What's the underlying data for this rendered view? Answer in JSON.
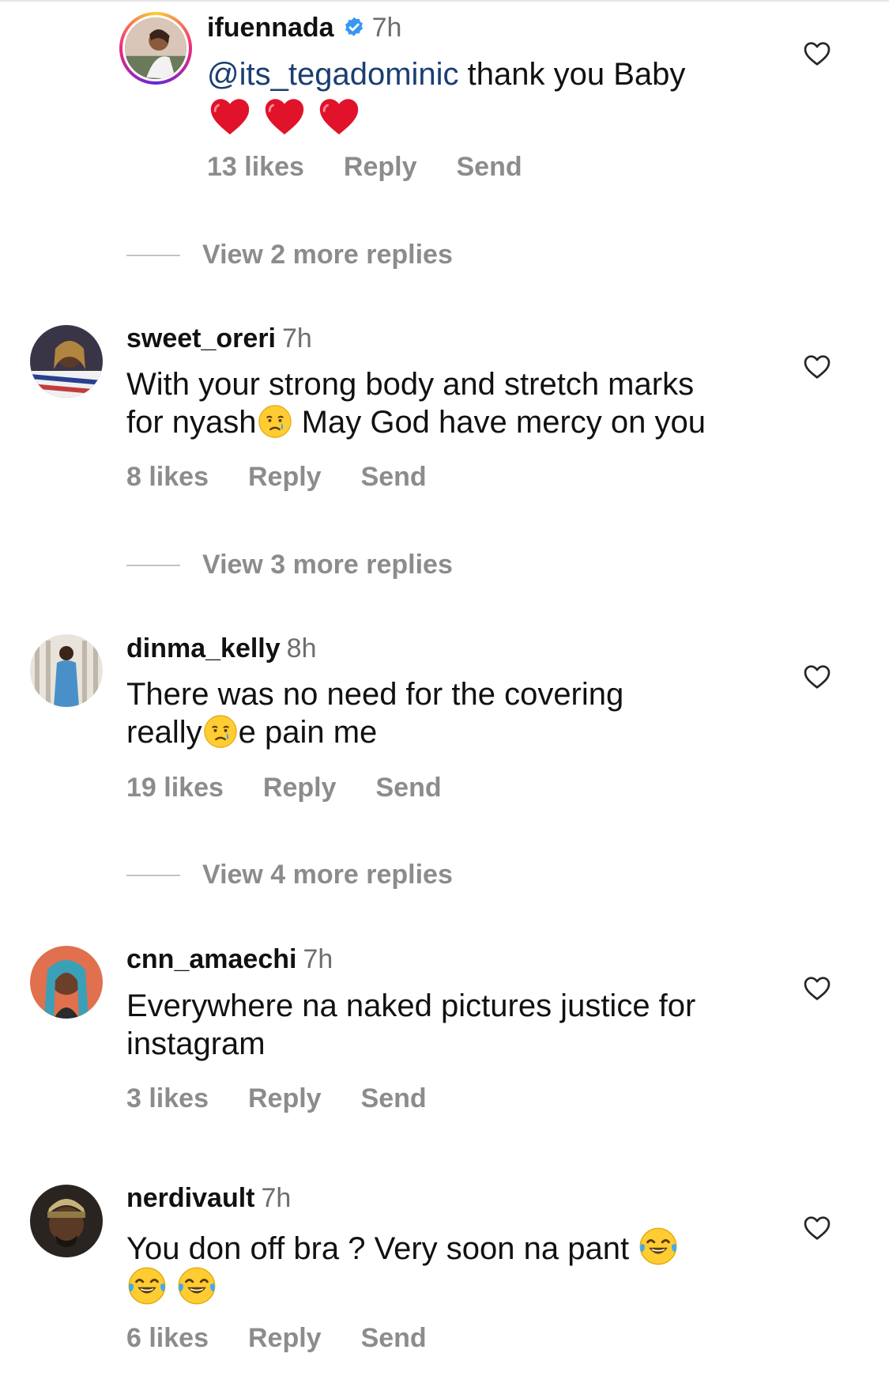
{
  "comments": [
    {
      "username": "ifuennada",
      "verified": true,
      "time": "7h",
      "mention": "@its_tegadominic",
      "text": "thank you Baby",
      "emoji_line": [
        "red-heart",
        "red-heart",
        "red-heart"
      ],
      "likes": "13 likes",
      "reply": "Reply",
      "send": "Send"
    },
    {
      "username": "sweet_oreri",
      "time": "7h",
      "line1": "With your strong body and stretch marks",
      "line2a": "for nyash",
      "line2b": " May God have mercy on you",
      "likes": "8 likes",
      "reply": "Reply",
      "send": "Send"
    },
    {
      "username": "dinma_kelly",
      "time": "8h",
      "line1": "There was no need for the covering",
      "line2a": "really",
      "line2b": "e pain me",
      "likes": "19 likes",
      "reply": "Reply",
      "send": "Send"
    },
    {
      "username": "cnn_amaechi",
      "time": "7h",
      "line1": "Everywhere na naked pictures justice for",
      "line2": "instagram",
      "likes": "3 likes",
      "reply": "Reply",
      "send": "Send"
    },
    {
      "username": "nerdivault",
      "time": "7h",
      "line1": "You don off bra ? Very soon na pant ",
      "likes": "6 likes",
      "reply": "Reply",
      "send": "Send"
    }
  ],
  "view_more": [
    "View 2 more replies",
    "View 3 more replies",
    "View 4 more replies"
  ],
  "colors": {
    "mention": "#1a3e73",
    "secondary_text": "#8c8c8c",
    "verified_badge": "#3897f0"
  }
}
